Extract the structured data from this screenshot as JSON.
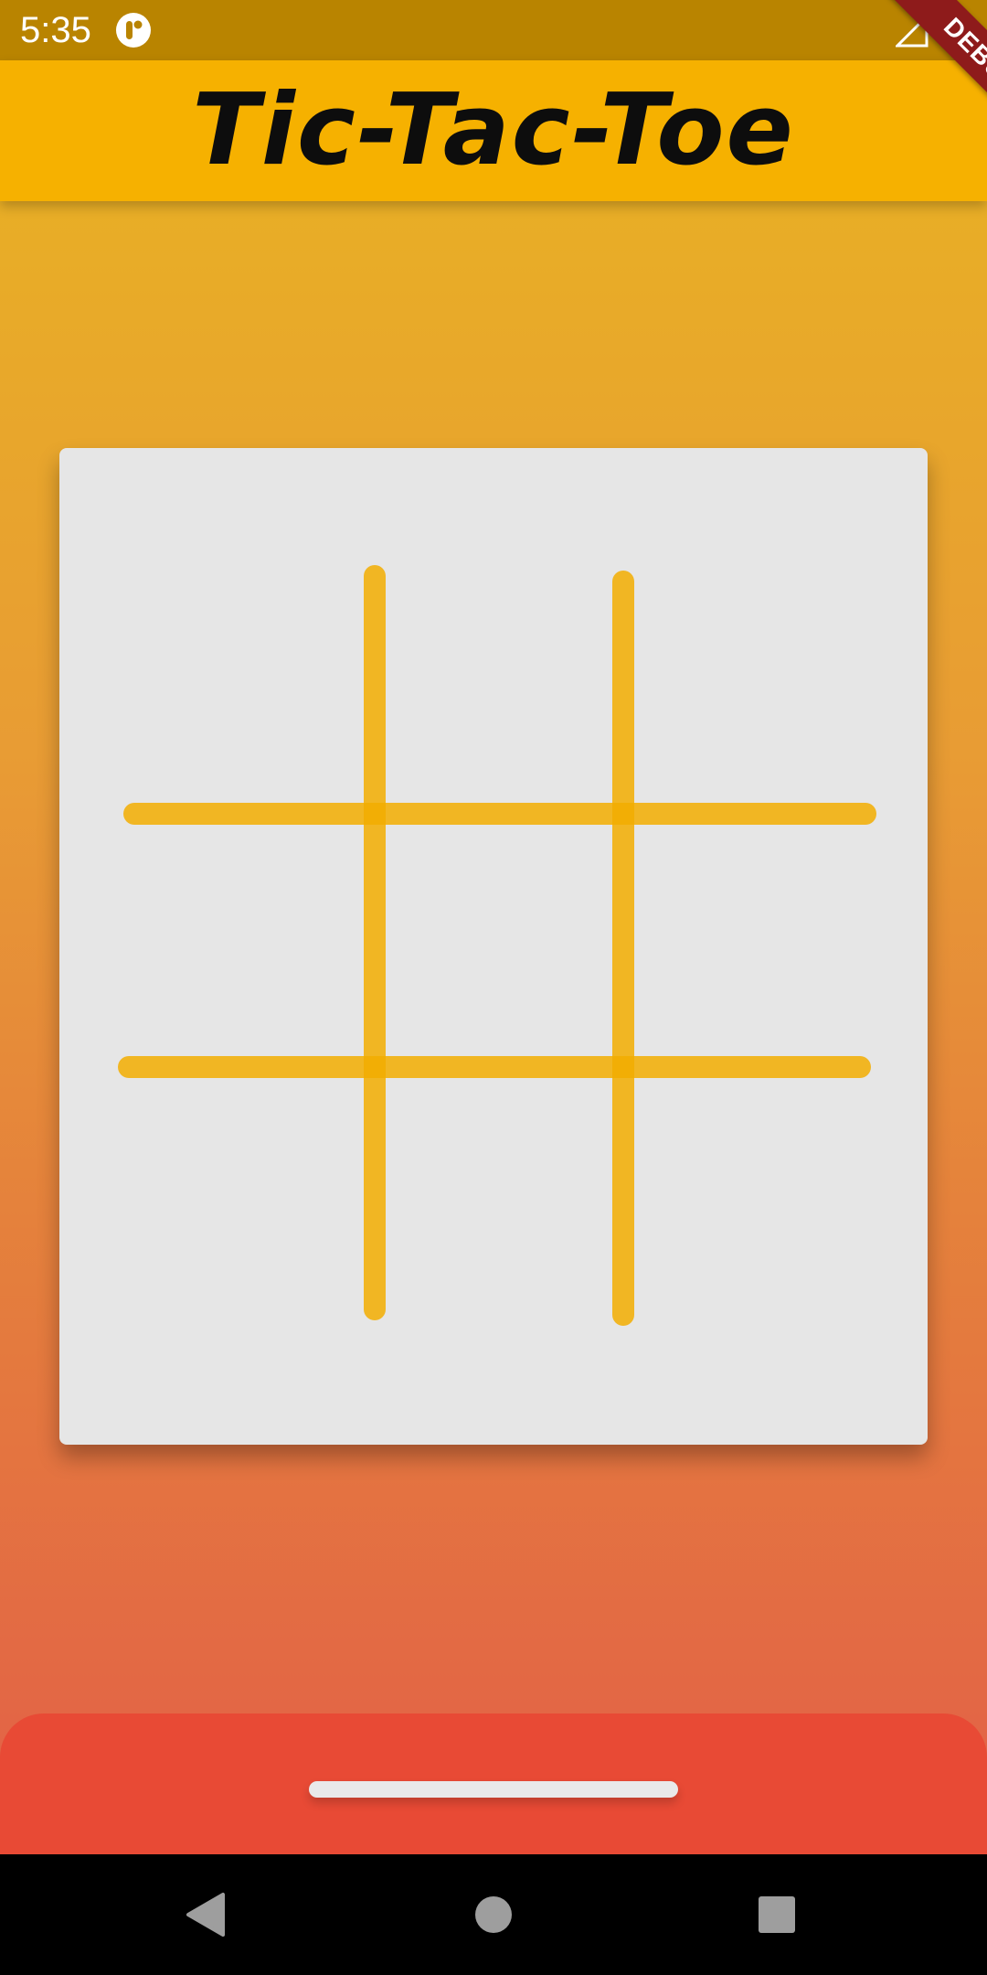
{
  "status_bar": {
    "time": "5:35",
    "app_icon": "notification-app-icon",
    "signal_icon": "signal-icon",
    "battery_icon": "battery-icon"
  },
  "app_bar": {
    "title": "Tic-Tac-Toe"
  },
  "debug_banner": {
    "label": "DEBUG"
  },
  "board": {
    "rows": 3,
    "cols": 3,
    "cells": [
      "",
      "",
      "",
      "",
      "",
      "",
      "",
      "",
      ""
    ],
    "line_color": "#f2ad00",
    "background_color": "#e6e6e6"
  },
  "bottom_sheet": {
    "color": "#e84a35",
    "handle_icon": "drag-handle"
  },
  "nav_bar": {
    "back_icon": "back-icon",
    "home_icon": "home-icon",
    "recents_icon": "recents-icon"
  },
  "colors": {
    "status_bar": "#b98400",
    "app_bar": "#f6b100",
    "gradient_top": "#e8b421",
    "gradient_bottom": "#e2594a",
    "debug_ribbon": "#8e1b1b"
  }
}
